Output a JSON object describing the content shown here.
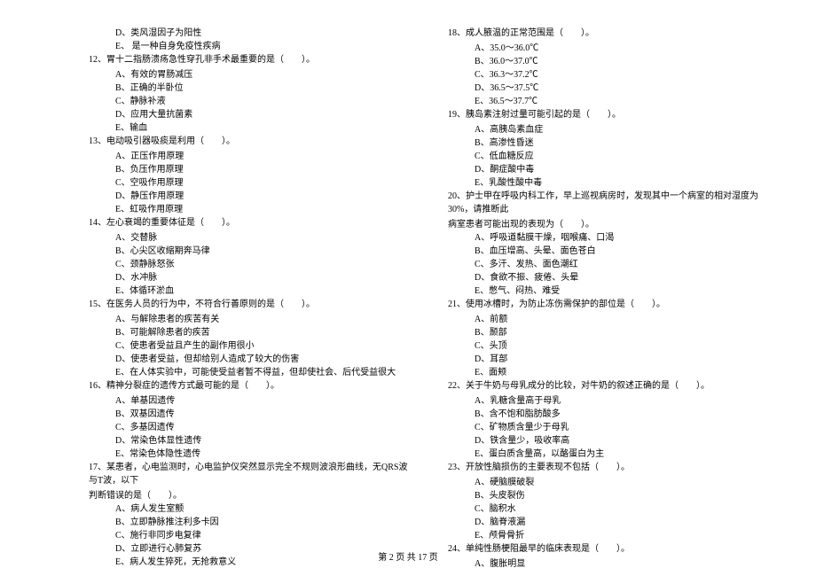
{
  "left_col": [
    {
      "type": "option",
      "text": "D、类风湿因子为阳性"
    },
    {
      "type": "option",
      "text": "E、 是一种自身免疫性疾病"
    },
    {
      "type": "question",
      "text": "12、胃十二指肠溃疡急性穿孔非手术最重要的是（　　）。"
    },
    {
      "type": "option",
      "text": "A、有效的胃肠减压"
    },
    {
      "type": "option",
      "text": "B、正确的半卧位"
    },
    {
      "type": "option",
      "text": "C、静脉补液"
    },
    {
      "type": "option",
      "text": "D、应用大量抗菌素"
    },
    {
      "type": "option",
      "text": "E、输血"
    },
    {
      "type": "question",
      "text": "13、电动吸引器吸痰是利用（　　）。"
    },
    {
      "type": "option",
      "text": "A、正压作用原理"
    },
    {
      "type": "option",
      "text": "B、负压作用原理"
    },
    {
      "type": "option",
      "text": "C、空吸作用原理"
    },
    {
      "type": "option",
      "text": "D、静压作用原理"
    },
    {
      "type": "option",
      "text": "E、虹吸作用原理"
    },
    {
      "type": "question",
      "text": "14、左心衰竭的重要体征是（　　）。"
    },
    {
      "type": "option",
      "text": "A、交替脉"
    },
    {
      "type": "option",
      "text": "B、心尖区收缩期奔马律"
    },
    {
      "type": "option",
      "text": "C、颈静脉怒张"
    },
    {
      "type": "option",
      "text": "D、水冲脉"
    },
    {
      "type": "option",
      "text": "E、体循环淤血"
    },
    {
      "type": "question",
      "text": "15、在医务人员的行为中，不符合行善原则的是（　　）。"
    },
    {
      "type": "option",
      "text": "A、与解除患者的疾苦有关"
    },
    {
      "type": "option",
      "text": "B、可能解除患者的疾苦"
    },
    {
      "type": "option",
      "text": "C、使患者受益且产生的副作用很小"
    },
    {
      "type": "option",
      "text": "D、使患者受益，但却给别人造成了较大的伤害"
    },
    {
      "type": "option",
      "text": "E、在人体实验中，可能使受益者暂不得益，但却使社会、后代受益很大"
    },
    {
      "type": "question",
      "text": "16、精神分裂症的遗传方式最可能的是（　　）。"
    },
    {
      "type": "option",
      "text": "A、单基因遗传"
    },
    {
      "type": "option",
      "text": "B、双基因遗传"
    },
    {
      "type": "option",
      "text": "C、多基因遗传"
    },
    {
      "type": "option",
      "text": "D、常染色体显性遗传"
    },
    {
      "type": "option",
      "text": "E、常染色体隐性遗传"
    },
    {
      "type": "question",
      "text": "17、某患者，心电监测时，心电监护仪突然显示完全不规则波浪形曲线，无QRS波与T波，以下"
    },
    {
      "type": "question-cont",
      "text": "判断错误的是（　　）。"
    },
    {
      "type": "option",
      "text": "A、病人发生室颤"
    },
    {
      "type": "option",
      "text": "B、立即静脉推注利多卡因"
    },
    {
      "type": "option",
      "text": "C、施行非同步电复律"
    },
    {
      "type": "option",
      "text": "D、立即进行心肺复苏"
    },
    {
      "type": "option",
      "text": "E、病人发生猝死，无抢救意义"
    }
  ],
  "right_col": [
    {
      "type": "question",
      "text": "18、成人腋温的正常范围是（　　）。"
    },
    {
      "type": "option",
      "text": "A、35.0～36.0℃"
    },
    {
      "type": "option",
      "text": "B、36.0～37.0℃"
    },
    {
      "type": "option",
      "text": "C、36.3～37.2℃"
    },
    {
      "type": "option",
      "text": "D、36.5～37.5℃"
    },
    {
      "type": "option",
      "text": "E、36.5～37.7℃"
    },
    {
      "type": "question",
      "text": "19、胰岛素注射过量可能引起的是（　　）。"
    },
    {
      "type": "option",
      "text": "A、高胰岛素血症"
    },
    {
      "type": "option",
      "text": "B、高渗性昏迷"
    },
    {
      "type": "option",
      "text": "C、低血糖反应"
    },
    {
      "type": "option",
      "text": "D、酮症酸中毒"
    },
    {
      "type": "option",
      "text": "E、乳酸性酸中毒"
    },
    {
      "type": "question",
      "text": "20、护士甲在呼吸内科工作，早上巡视病房时，发现其中一个病室的相对湿度为30%，请推断此"
    },
    {
      "type": "question-cont",
      "text": "病室患者可能出现的表现为（　　）。"
    },
    {
      "type": "option",
      "text": "A、呼吸道黏膜干燥，咽喉痛、口渴"
    },
    {
      "type": "option",
      "text": "B、血压增高、头晕、面色苍白"
    },
    {
      "type": "option",
      "text": "C、多汗、发热、面色潮红"
    },
    {
      "type": "option",
      "text": "D、食欲不振、疲倦、头晕"
    },
    {
      "type": "option",
      "text": "E、憋气、闷热、难受"
    },
    {
      "type": "question",
      "text": "21、使用冰槽时，为防止冻伤需保护的部位是（　　）。"
    },
    {
      "type": "option",
      "text": "A、前额"
    },
    {
      "type": "option",
      "text": "B、颞部"
    },
    {
      "type": "option",
      "text": "C、头顶"
    },
    {
      "type": "option",
      "text": "D、耳部"
    },
    {
      "type": "option",
      "text": "E、面颊"
    },
    {
      "type": "question",
      "text": "22、关于牛奶与母乳成分的比较，对牛奶的叙述正确的是（　　）。"
    },
    {
      "type": "option",
      "text": "A、乳糖含量高于母乳"
    },
    {
      "type": "option",
      "text": "B、含不饱和脂肪酸多"
    },
    {
      "type": "option",
      "text": "C、矿物质含量少于母乳"
    },
    {
      "type": "option",
      "text": "D、铁含量少，吸收率高"
    },
    {
      "type": "option",
      "text": "E、蛋白质含量高，以酪蛋白为主"
    },
    {
      "type": "question",
      "text": "23、开放性脑损伤的主要表现不包括（　　）。"
    },
    {
      "type": "option",
      "text": "A、硬脑膜破裂"
    },
    {
      "type": "option",
      "text": "B、头皮裂伤"
    },
    {
      "type": "option",
      "text": "C、脑积水"
    },
    {
      "type": "option",
      "text": "D、脑脊液漏"
    },
    {
      "type": "option",
      "text": "E、颅骨骨折"
    },
    {
      "type": "question",
      "text": "24、单纯性肠梗阻最早的临床表现是（　　）。"
    },
    {
      "type": "option",
      "text": "A、腹胀明显"
    }
  ],
  "footer": "第 2 页 共 17 页"
}
